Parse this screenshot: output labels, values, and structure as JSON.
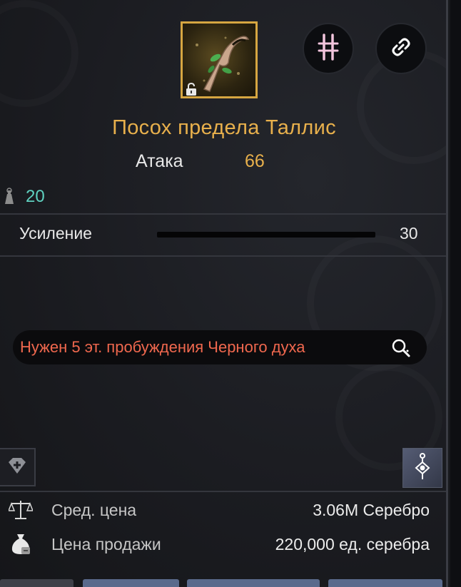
{
  "item": {
    "name": "Посох предела Таллис",
    "icon": "staff-item-icon",
    "locked": true
  },
  "header_buttons": {
    "compare_icon": "compare-icon",
    "link_icon": "link-icon"
  },
  "stats": {
    "attack_label": "Атака",
    "attack_value": "66",
    "weight_value": "20"
  },
  "enhancement": {
    "label": "Усиление",
    "value": "30"
  },
  "requirement": {
    "text": "Нужен 5 эт. пробуждения Черного духа"
  },
  "prices": {
    "avg_label": "Сред. цена",
    "avg_value": "3.06M Серебро",
    "sell_label": "Цена продажи",
    "sell_value": "220,000 ед. серебра"
  },
  "colors": {
    "title": "#e8b04c",
    "weight": "#5fd1c0",
    "requirement": "#f0684e",
    "icon_border": "#d6a641"
  }
}
